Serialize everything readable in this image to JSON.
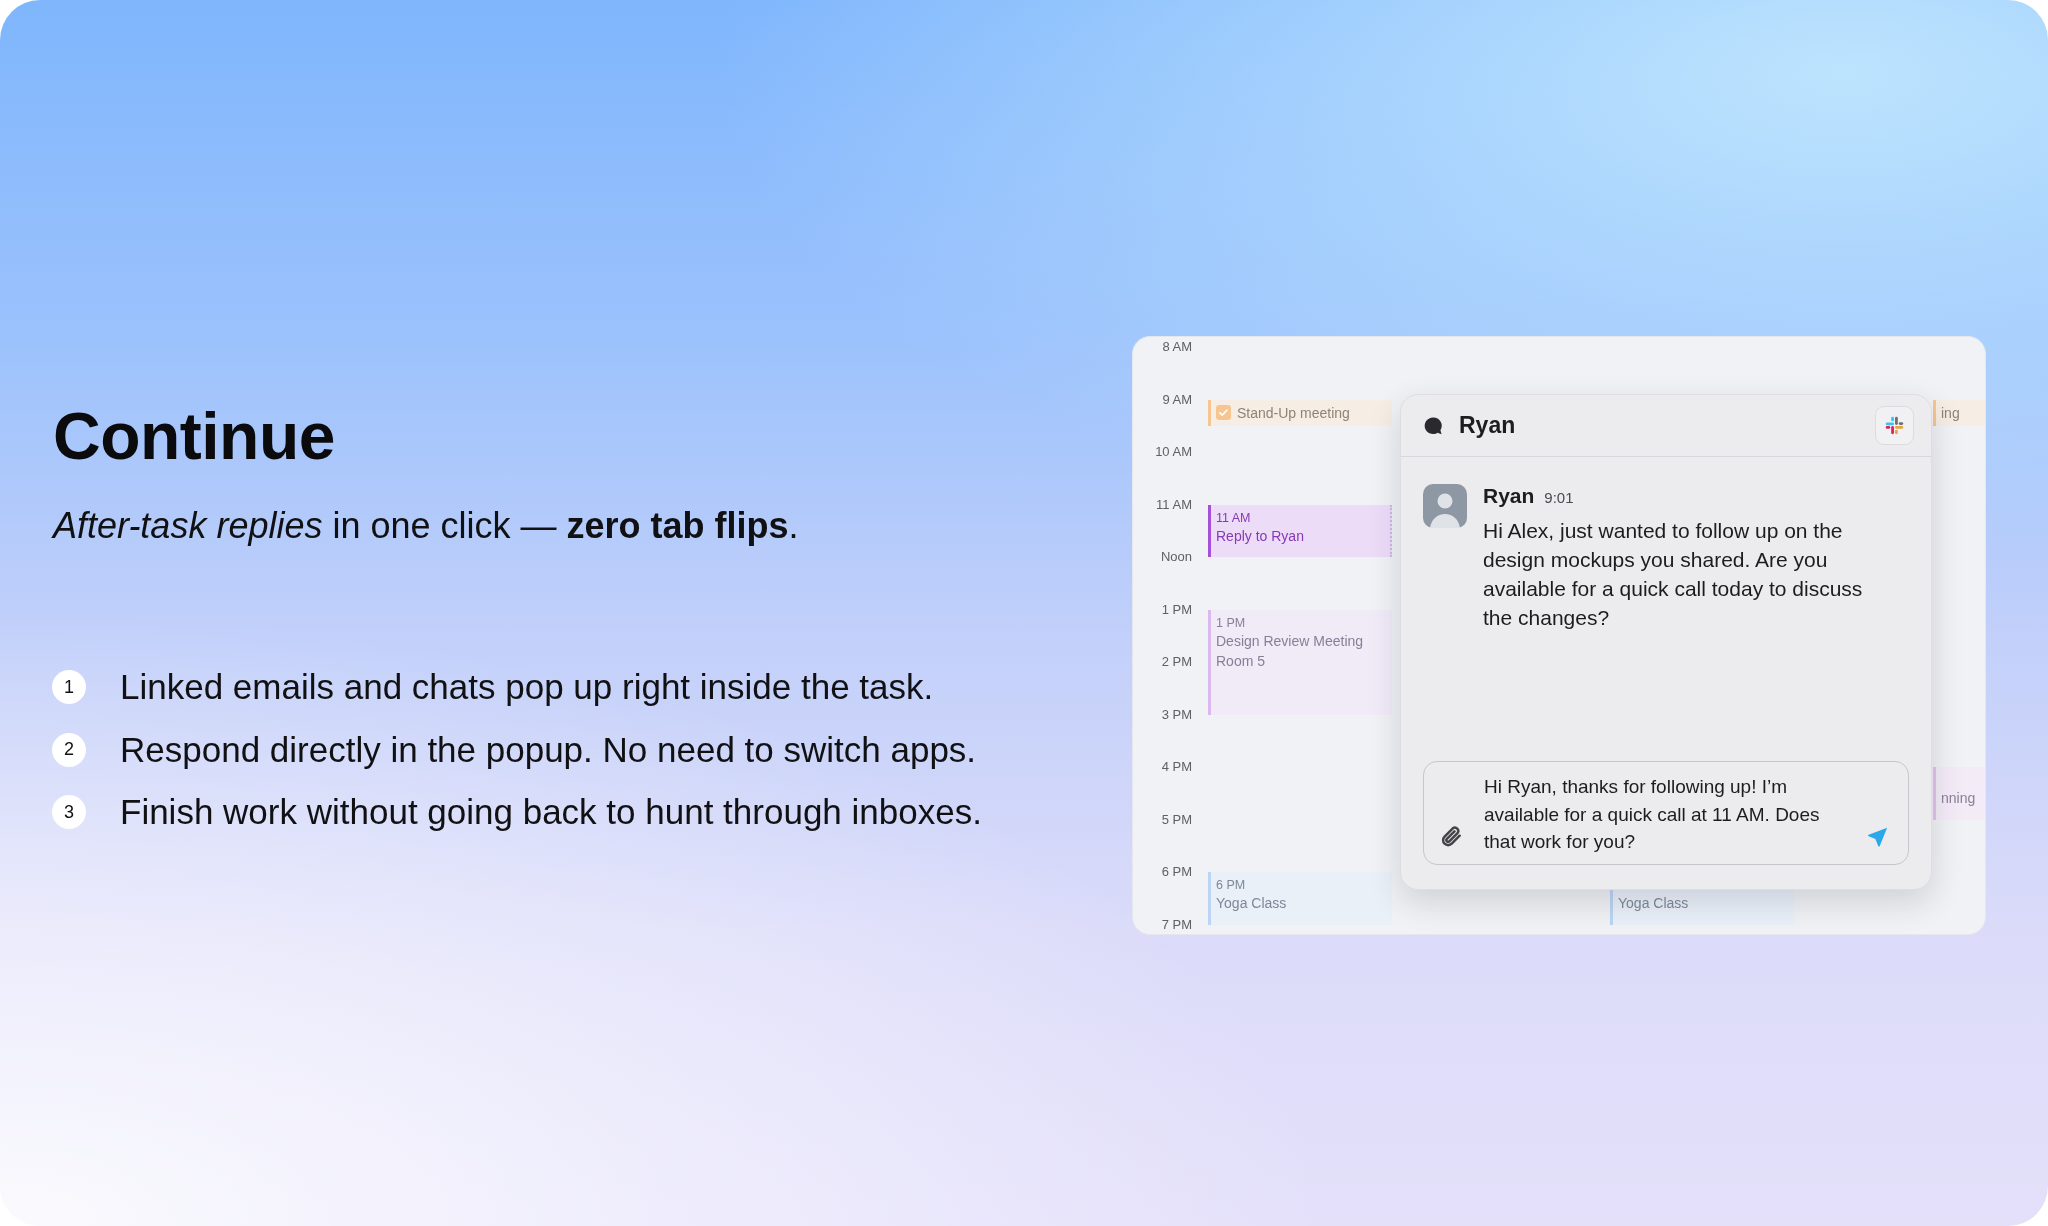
{
  "heading": "Continue",
  "subtitle": "*After-task replies* in one click — **zero tab flips**.",
  "steps": [
    {
      "number": "1",
      "text": "Linked emails and chats pop up right inside the task."
    },
    {
      "number": "2",
      "text": "Respond directly in the popup. No need to switch apps."
    },
    {
      "number": "3",
      "text": "Finish work without going back to hunt through inboxes."
    }
  ],
  "calendar": {
    "hours": [
      {
        "label": "8 AM"
      },
      {
        "label": "9 AM",
        "column_1": {
          "kind": "task",
          "title": "Stand-Up meeting",
          "checked": true,
          "dimmed": true,
          "color": "#f7c590"
        },
        "column_3": {
          "kind": "task",
          "title": "ing",
          "dimmed": true,
          "color": "#f7c590"
        }
      },
      {
        "label": "10 AM"
      },
      {
        "label": "11 AM",
        "column_1": {
          "kind": "meeting",
          "time": "11 AM",
          "title": "Reply to Ryan",
          "dimmed": false,
          "color": "#a64fdb"
        }
      },
      {
        "label": "Noon"
      },
      {
        "label": "1 PM",
        "column_1": {
          "kind": "meeting",
          "time": "1 PM",
          "title": "Design Review Meeting",
          "location": "Room 5",
          "dimmed": true,
          "color": "#dcb8f0"
        }
      },
      {
        "label": "2 PM"
      },
      {
        "label": "3 PM"
      },
      {
        "label": "4 PM",
        "column_3": {
          "kind": "meeting",
          "title": "nning",
          "dimmed": true,
          "color": "#e5c2ee"
        }
      },
      {
        "label": "5 PM"
      },
      {
        "label": "6 PM",
        "column_1": {
          "kind": "meeting",
          "time": "6 PM",
          "title": "Yoga Class",
          "dimmed": true,
          "color": "#bcd5f4"
        },
        "column_2": {
          "kind": "meeting",
          "title": "Yoga Class",
          "dimmed": true,
          "color": "#bcd5f4"
        }
      },
      {
        "label": "7 PM"
      }
    ]
  },
  "chat": {
    "title": "Ryan",
    "message": {
      "author": "Ryan",
      "time": "9:01",
      "text": "Hi Alex, just wanted to follow up on the design mockups you shared. Are you available for a quick call today to discuss the changes?"
    },
    "reply": {
      "value": "Hi Ryan, thanks for following up! I’m available for a quick call at 11 AM. Does that work for you?"
    }
  }
}
